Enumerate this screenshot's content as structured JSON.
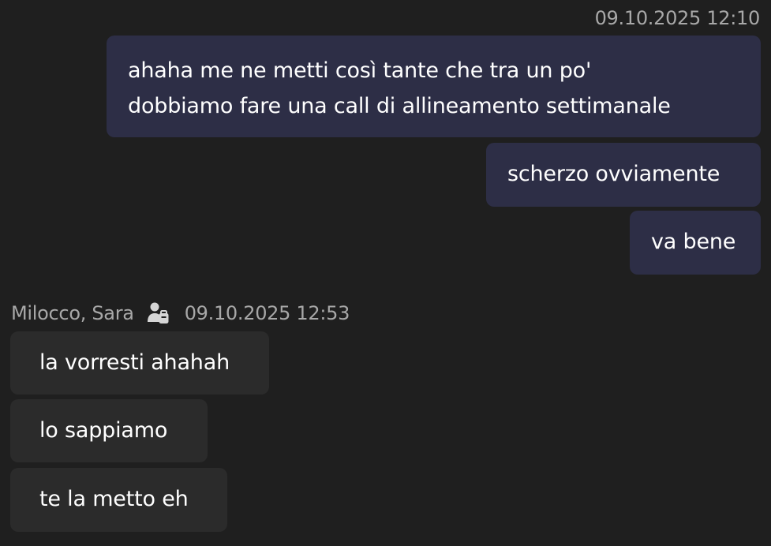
{
  "outgoing": {
    "timestamp": "09.10.2025 12:10",
    "messages": [
      {
        "lines": [
          "ahaha me ne metti così tante che tra un po'",
          "dobbiamo fare una call di allineamento settimanale"
        ]
      },
      {
        "lines": [
          "scherzo ovviamente"
        ]
      },
      {
        "lines": [
          "va bene"
        ]
      }
    ]
  },
  "incoming": {
    "sender": "Milocco, Sara",
    "sender_icon": "external-user-icon",
    "timestamp": "09.10.2025 12:53",
    "messages": [
      {
        "text": "la vorresti ahahah"
      },
      {
        "text": "lo sappiamo"
      },
      {
        "text": "te la metto eh"
      }
    ]
  },
  "colors": {
    "background": "#1f1f1f",
    "outgoing_bubble": "#2d2e46",
    "incoming_bubble": "#2b2b2b",
    "meta_text": "#a8a8a8",
    "message_text": "#ffffff"
  }
}
